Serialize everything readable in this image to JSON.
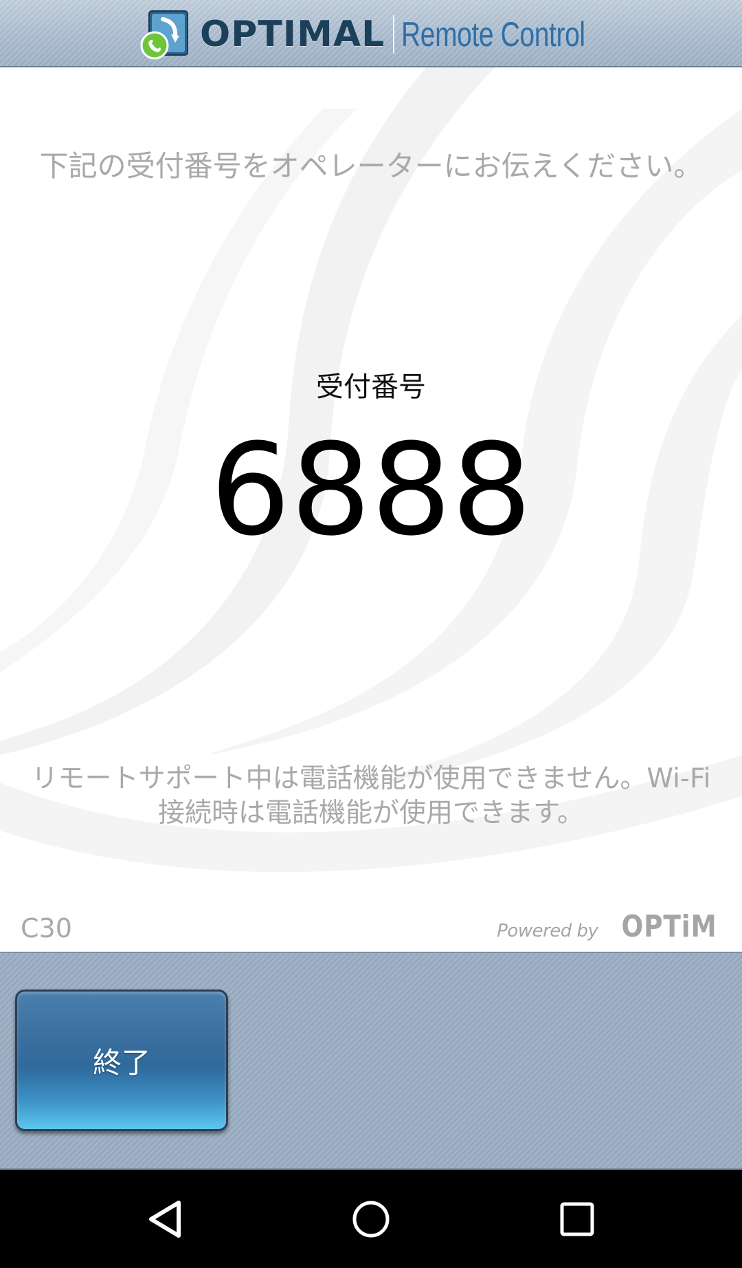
{
  "header": {
    "brand": "OPTIMAL",
    "product": "Remote Control",
    "logo_icon": "phone-arrow-icon"
  },
  "main": {
    "instruction": "下記の受付番号をオペレーターにお伝えください。",
    "reception_label": "受付番号",
    "reception_number": "6888",
    "notice_line1": "リモートサポート中は電話機能が使用できません。Wi-Fi",
    "notice_line2": "接続時は電話機能が使用できます。",
    "version": "C30",
    "powered_by": "Powered by",
    "powered_brand": "OPTiM"
  },
  "toolbar": {
    "end_label": "終了"
  },
  "navbar": {
    "back_icon": "back-triangle-icon",
    "home_icon": "home-circle-icon",
    "recents_icon": "recents-square-icon"
  },
  "colors": {
    "header_bg": "#aebfd1",
    "brand_text": "#1c3f5a",
    "product_text": "#2e6fa8",
    "toolbar_bg": "#9aadc3",
    "button_top": "#3a6e9f",
    "button_bottom": "#5cc6ee",
    "muted_text": "#a9a9a9"
  }
}
